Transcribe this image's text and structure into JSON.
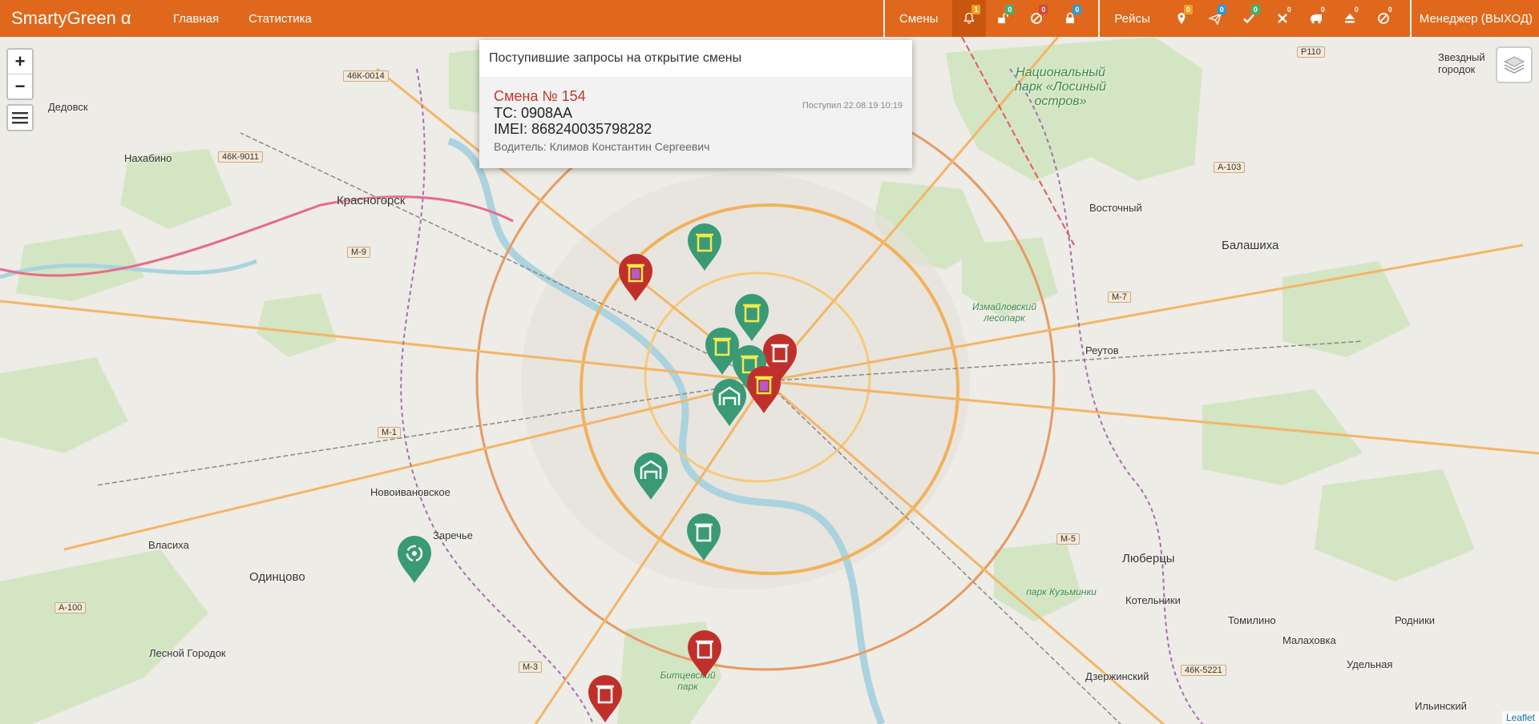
{
  "navbar": {
    "brand": "SmartyGreen α",
    "links": [
      "Главная",
      "Статистика"
    ],
    "shifts_label": "Смены",
    "trips_label": "Рейсы",
    "user_label": "Менеджер (ВЫХОД)",
    "shift_icons": [
      {
        "icon": "bell-icon",
        "count": "1",
        "color": "#f0a020"
      },
      {
        "icon": "unlock-icon",
        "count": "0",
        "color": "#3cb371"
      },
      {
        "icon": "ban-icon",
        "count": "0",
        "color": "#d9443a"
      },
      {
        "icon": "lock-icon",
        "count": "0",
        "color": "#2e9ad0"
      }
    ],
    "trip_icons": [
      {
        "icon": "map-marker-icon",
        "count": "0",
        "color": "#f0a020"
      },
      {
        "icon": "paper-plane-icon",
        "count": "0",
        "color": "#2e9ad0"
      },
      {
        "icon": "check-icon",
        "count": "0",
        "color": "#3cb371"
      },
      {
        "icon": "times-icon",
        "count": "0"
      },
      {
        "icon": "truck-icon",
        "count": "0"
      },
      {
        "icon": "eject-icon",
        "count": "0"
      },
      {
        "icon": "ban-icon",
        "count": "0"
      }
    ]
  },
  "popup": {
    "title": "Поступившие запросы на открытие смены",
    "shift": "Смена № 154",
    "vehicle": "ТС: 0908АА",
    "imei": "IMEI: 868240035798282",
    "driver": "Водитель: Климов Константин Сергеевич",
    "received": "Поступил 22.08.19 10:19"
  },
  "map": {
    "zoom_in": "+",
    "zoom_out": "−",
    "attribution": "Leaflet",
    "cities": [
      "Красногорск",
      "Балашиха",
      "Одинцово",
      "Люберцы",
      "Дедовск",
      "Нахабино",
      "Восточный",
      "Реутов",
      "Новоивановское",
      "Заречье",
      "Власиха",
      "Лесной Городок",
      "Котельники",
      "Томилино",
      "Родники",
      "Малаховка",
      "Дзержинский",
      "Удельная",
      "Ильинский",
      "Звездный городок"
    ],
    "parks": [
      "Национальный парк «Лосиный остров»",
      "Измайловский лесопарк",
      "парк Кузьминки",
      "Битцевский парк"
    ],
    "roads": [
      "46К-0014",
      "46К-9011",
      "М-9",
      "М-1",
      "М-7",
      "М-5",
      "М-3",
      "А-100",
      "А-103",
      "Р110",
      "46К-5221"
    ],
    "markers": [
      {
        "type": "trash",
        "status": "ok"
      },
      {
        "type": "trash",
        "status": "alert"
      },
      {
        "type": "depot",
        "status": "ok"
      },
      {
        "type": "depot",
        "status": "ok"
      },
      {
        "type": "trash",
        "status": "ok"
      },
      {
        "type": "recycle",
        "status": "ok"
      },
      {
        "type": "trash",
        "status": "alert"
      },
      {
        "type": "trash",
        "status": "alert"
      }
    ]
  },
  "colors": {
    "accent": "#e0681c",
    "marker_green": "#3a9a76",
    "marker_red": "#c0302a"
  }
}
